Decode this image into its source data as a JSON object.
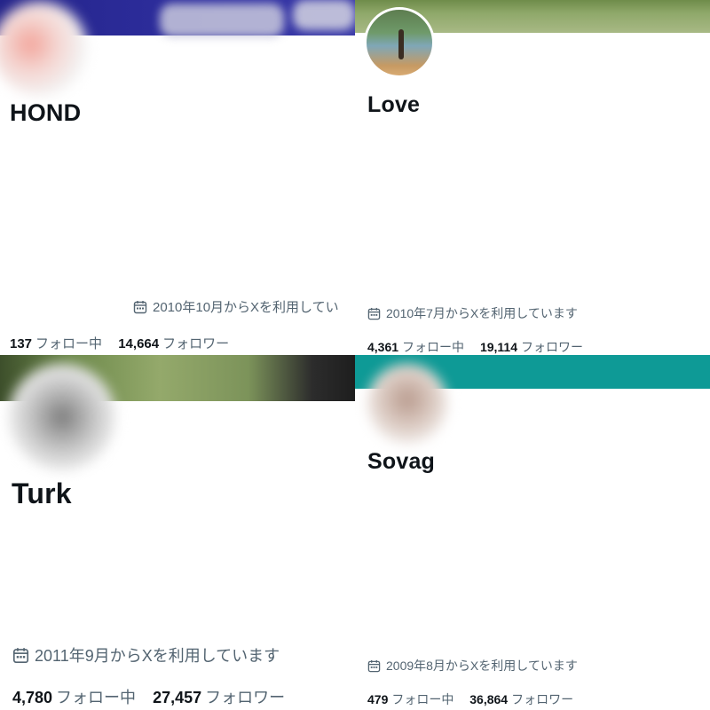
{
  "colors": {
    "text": "#0f1419",
    "muted": "#536471",
    "banner_navy": "#2a2a8c",
    "banner_teal": "#0e9a96"
  },
  "profiles": [
    {
      "name": "HOND",
      "joined": "2010年10月からXを利用してい",
      "following_count": "137",
      "following_label": "フォロー中",
      "followers_count": "14,664",
      "followers_label": "フォロワー"
    },
    {
      "name": "Love",
      "joined": "2010年7月からXを利用しています",
      "following_count": "4,361",
      "following_label": "フォロー中",
      "followers_count": "19,114",
      "followers_label": "フォロワー"
    },
    {
      "name": "Turk",
      "joined": "2011年9月からXを利用しています",
      "following_count": "4,780",
      "following_label": "フォロー中",
      "followers_count": "27,457",
      "followers_label": "フォロワー"
    },
    {
      "name": "Sovag",
      "joined": "2009年8月からXを利用しています",
      "following_count": "479",
      "following_label": "フォロー中",
      "followers_count": "36,864",
      "followers_label": "フォロワー"
    }
  ]
}
